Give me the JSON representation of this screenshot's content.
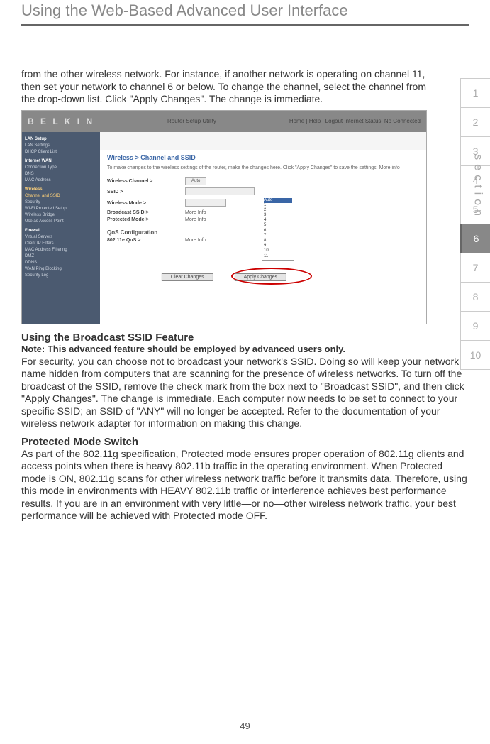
{
  "page_title": "Using the Web-Based Advanced User Interface",
  "intro_para": "from the other wireless network. For instance, if another network is operating on channel 11, then set your network to channel 6 or below. To change the channel, select the channel from the drop-down list. Click \"Apply Changes\". The change is immediate.",
  "figure": {
    "brand": "B E L K I N",
    "utility_title": "Router Setup Utility",
    "top_links": "Home | Help | Logout   Internet Status: No Connected",
    "nav": {
      "group1_hdr": "LAN Setup",
      "group1_items": [
        "LAN Settings",
        "DHCP Client List"
      ],
      "group2_hdr": "Internet WAN",
      "group2_items": [
        "Connection Type",
        "DNS",
        "MAC Address"
      ],
      "group3_hdr": "Wireless",
      "group3_items": [
        "Channel and SSID",
        "Security",
        "Wi-Fi Protected Setup",
        "Wireless Bridge",
        "Use as Access Point"
      ],
      "group4_hdr": "Firewall",
      "group4_items": [
        "Virtual Servers",
        "Client IP Filters",
        "MAC Address Filtering",
        "DMZ",
        "DDNS",
        "WAN Ping Blocking",
        "Security Log"
      ]
    },
    "breadcrumb": "Wireless > Channel and SSID",
    "hint": "To make changes to the wireless settings of the router, make the changes here. Click \"Apply Changes\" to save the settings. More info",
    "rows": {
      "channel_lbl": "Wireless Channel >",
      "channel_val": "Auto",
      "ssid_lbl": "SSID >",
      "mode_lbl": "Wireless Mode >",
      "bcast_lbl": "Broadcast SSID >",
      "prot_lbl": "Protected Mode >",
      "qos_hdr": "QoS Configuration",
      "qos_lbl": "802.11e QoS >",
      "more": "More Info"
    },
    "dropdown_options": [
      "Auto",
      "1",
      "2",
      "3",
      "4",
      "5",
      "6",
      "7",
      "8",
      "9",
      "10",
      "11"
    ],
    "btn_clear": "Clear Changes",
    "btn_apply": "Apply Changes"
  },
  "section1_heading": "Using the Broadcast SSID Feature",
  "section1_note": "Note: This advanced feature should be employed by advanced users only.",
  "section1_para": "For security, you can choose not to broadcast your network's SSID. Doing so will keep your network name hidden from computers that are scanning for the presence of wireless networks. To turn off the broadcast of the SSID, remove the check mark from the box next to \"Broadcast SSID\", and then click \"Apply Changes\". The change is immediate. Each computer now needs to be set to connect to your specific SSID; an SSID of \"ANY\" will no longer be accepted. Refer to the documentation of your wireless network adapter for information on making this change.",
  "section2_heading": "Protected Mode Switch",
  "section2_para": "As part of the 802.11g specification, Protected mode ensures proper operation of 802.11g clients and access points when there is heavy 802.11b traffic in the operating environment. When Protected mode is ON, 802.11g scans for other wireless network traffic before it transmits data. Therefore, using this mode in environments with HEAVY 802.11b traffic or interference achieves best performance results. If you are in an environment with very little—or no—other wireless network traffic, your best performance will be achieved with Protected mode OFF.",
  "side_tabs": [
    "1",
    "2",
    "3",
    "4",
    "5",
    "6",
    "7",
    "8",
    "9",
    "10"
  ],
  "active_tab_index": 5,
  "section_label": "section",
  "page_number": "49"
}
